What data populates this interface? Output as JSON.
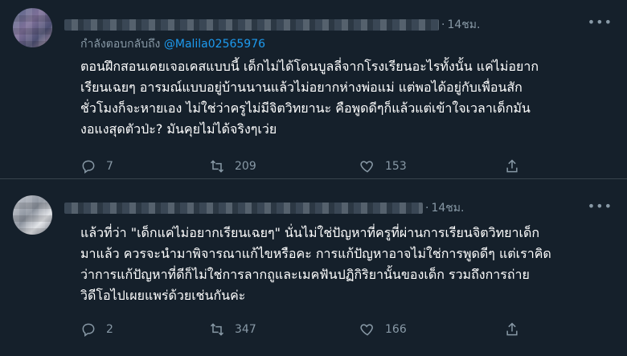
{
  "tweets": [
    {
      "time": "14ชม.",
      "replying_to_prefix": "กำลังตอบกลับถึง",
      "replying_to_handle": "@Malila02565976",
      "lines": [
        "ตอนฝึกสอนเคยเจอเคสแบบนี้ เด็กไม่ได้โดนบูลลี่จากโรงเรียนอะไรทั้งนั้น แค่ไม่อยาก",
        "เรียนเฉยๆ อารมณ์แบบอยู่บ้านนานแล้วไม่อยากห่างพ่อแม่ แต่พอได้อยู่กับเพื่อนสัก",
        "ชั่วโมงก็จะหายเอง ไม่ใช่ว่าครูไม่มีจิตวิทยานะ คือพูดดีๆก็แล้วแต่เข้าใจเวลาเด็กมัน",
        "งอแงสุดตัวป่ะ? มันคุยไม่ได้จริงๆเว่ย"
      ],
      "replies": "7",
      "retweets": "209",
      "likes": "153"
    },
    {
      "time": "14ชม.",
      "lines": [
        "แล้วที่ว่า \"เด็กแค่ไม่อยากเรียนเฉยๆ\" นั่นไม่ใช่ปัญหาที่ครูที่ผ่านการเรียนจิตวิทยาเด็ก",
        "มาแล้ว ควรจะนำมาพิจารณาแก้ไขหรือคะ การแก้ปัญหาอาจไม่ใช่การพูดดีๆ แต่เราคิด",
        "ว่าการแก้ปัญหาที่ดีก็ไม่ใช่การลากถูและเมคฟันปฏิกิริยานั้นของเด็ก รวมถึงการถ่าย",
        "วิดีโอไปเผยแพร่ด้วยเช่นกันค่ะ"
      ],
      "replies": "2",
      "retweets": "347",
      "likes": "166"
    }
  ],
  "icons": {
    "more": "more-horizontal-icon",
    "reply": "reply-icon",
    "retweet": "retweet-icon",
    "like": "heart-icon",
    "share": "share-icon"
  },
  "colors": {
    "background": "#15202b",
    "text": "#ffffff",
    "muted": "#8899a6",
    "link": "#1d9bf0",
    "divider": "#38444d"
  }
}
